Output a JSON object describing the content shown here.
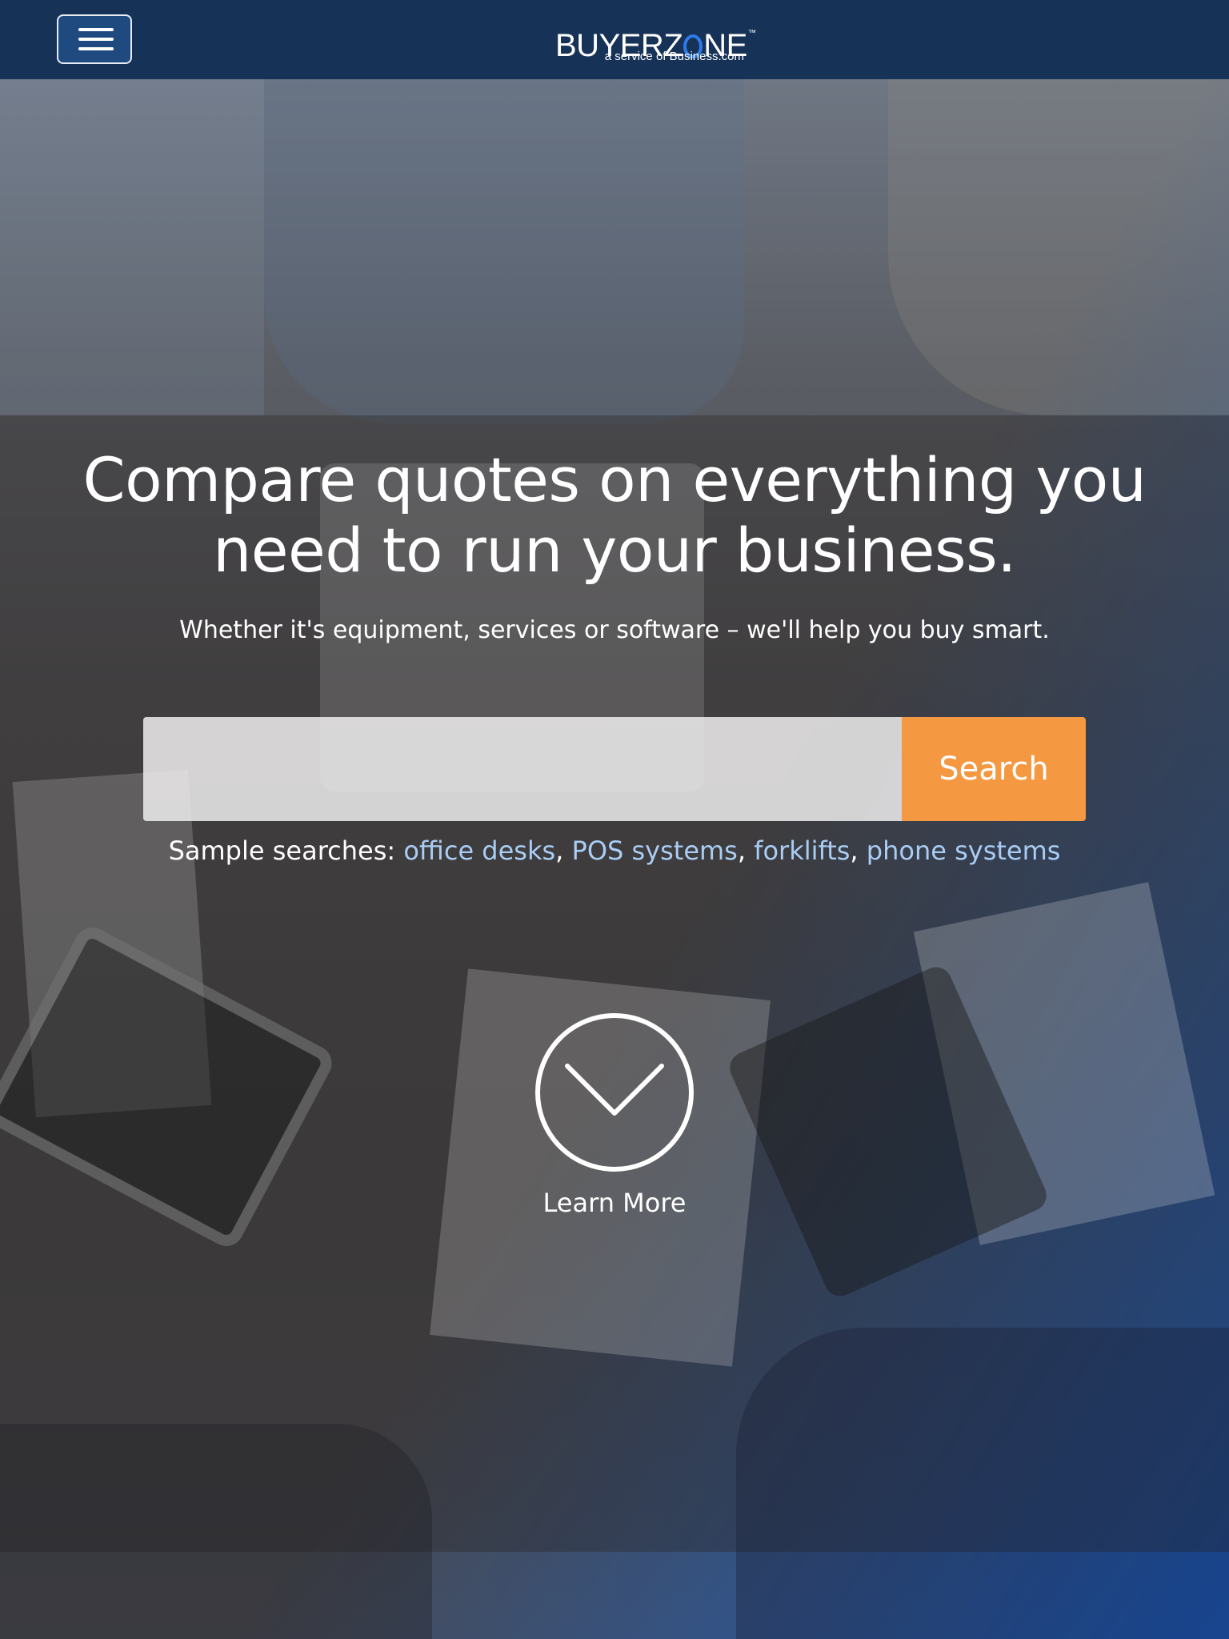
{
  "header": {
    "menu_icon": "hamburger-menu-icon",
    "logo": {
      "word_before": "BUYERZ",
      "word_after": "NE",
      "trademark": "™",
      "tagline": "a service of Business.com"
    }
  },
  "hero": {
    "title": "Compare quotes on everything you need to run your business.",
    "subtitle": "Whether it's equipment, services or software – we'll help you buy smart.",
    "search": {
      "value": "",
      "placeholder": "",
      "button_label": "Search"
    },
    "samples": {
      "label": "Sample searches:",
      "links": [
        "office desks",
        "POS systems",
        "forklifts",
        "phone systems"
      ],
      "separator": ","
    },
    "learn_more": {
      "label": "Learn More",
      "icon": "chevron-down-icon"
    }
  },
  "colors": {
    "header_bg": "#173257",
    "accent_orange": "#f59842",
    "link_blue": "#a9cdf4",
    "logo_ring_blue": "#2d7bea"
  }
}
